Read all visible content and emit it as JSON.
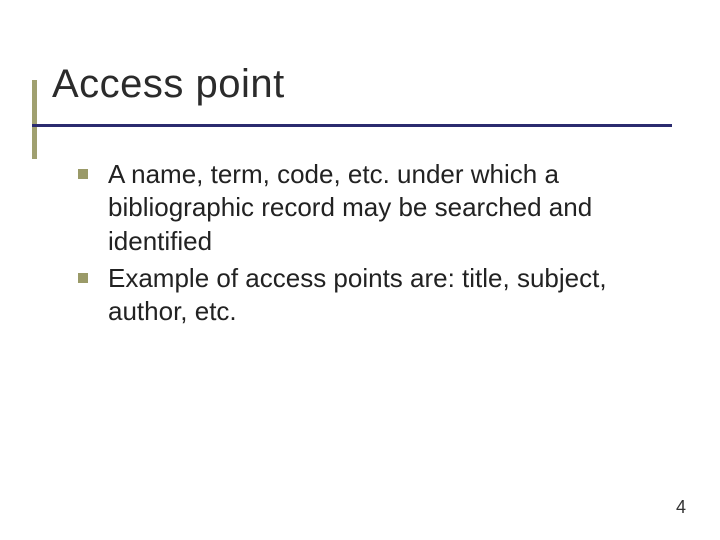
{
  "slide": {
    "title": "Access point",
    "bullets": [
      {
        "text": "A name, term, code, etc. under which a bibliographic record may be searched and identified"
      },
      {
        "text": "Example of access points are: title, subject, author, etc."
      }
    ],
    "page_number": "4"
  }
}
